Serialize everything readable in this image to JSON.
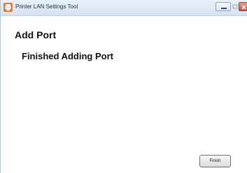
{
  "window": {
    "title": "Printer LAN Settings Tool",
    "app_icon": "printer-app-icon",
    "controls": [
      "minimize-icon",
      "maximize-icon",
      "close-icon"
    ]
  },
  "main": {
    "header": "Add Port",
    "subheader": "Finished Adding Port"
  },
  "footer": {
    "finish_label": "Finish"
  },
  "colors": {
    "titlebar": "#d6e3f2",
    "close_button": "#c6543f",
    "background": "#ffffff"
  }
}
